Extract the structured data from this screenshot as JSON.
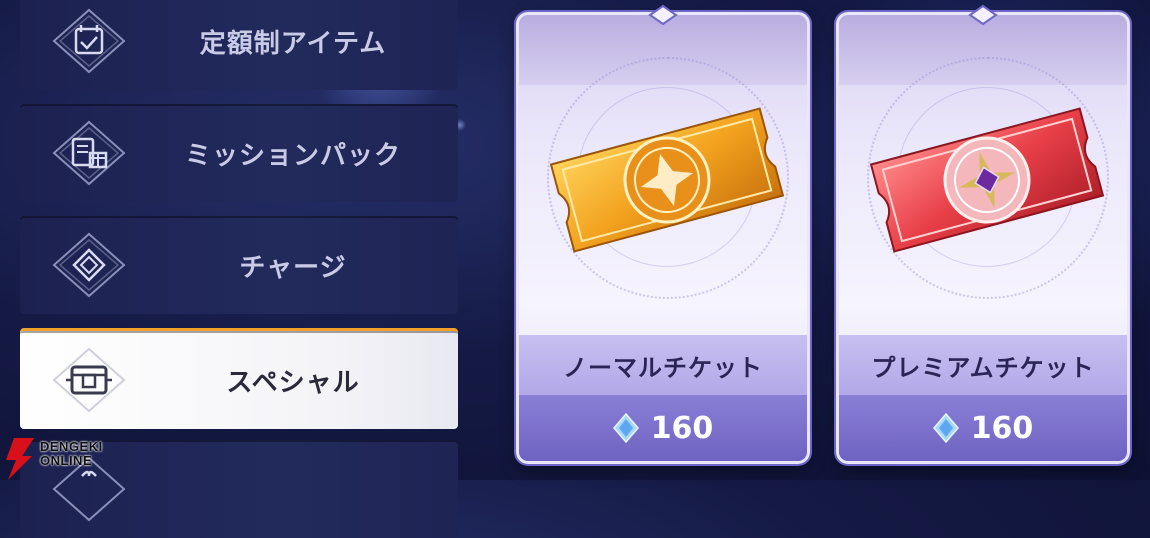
{
  "sidebar": {
    "items": [
      {
        "label": "定額制アイテム",
        "icon": "calendar-check-icon",
        "active": false
      },
      {
        "label": "ミッションパック",
        "icon": "gift-list-icon",
        "active": false
      },
      {
        "label": "チャージ",
        "icon": "diamond-icon",
        "active": false
      },
      {
        "label": "スペシャル",
        "icon": "treasure-box-icon",
        "active": true
      },
      {
        "label": "",
        "icon": "gift-icon",
        "active": false
      }
    ]
  },
  "shop": {
    "cards": [
      {
        "name": "ノーマルチケット",
        "price": "160",
        "currency_icon": "crystal-gem-icon",
        "ticket_color": "#f2a21e"
      },
      {
        "name": "プレミアムチケット",
        "price": "160",
        "currency_icon": "crystal-gem-icon",
        "ticket_color": "#e83f48"
      }
    ]
  },
  "watermark": {
    "line1": "DENGEKI",
    "line2": "ONLINE"
  },
  "colors": {
    "accent": "#f2a02a",
    "card_border": "#6e66c9",
    "price_bar": "#7a6ecb"
  }
}
